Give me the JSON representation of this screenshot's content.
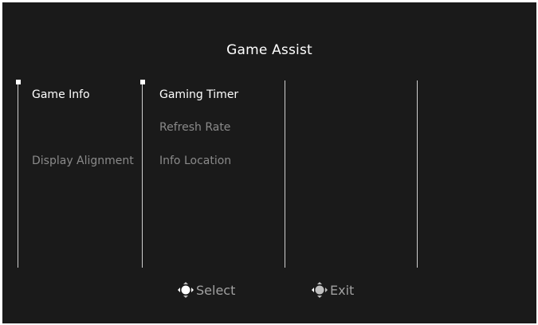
{
  "osd": {
    "title": "Game Assist",
    "column1": [
      {
        "label": "Game Info",
        "state": "active"
      },
      {
        "label": "Display Alignment",
        "state": "inactive"
      }
    ],
    "column2": [
      {
        "label": "Gaming Timer",
        "state": "active"
      },
      {
        "label": "Refresh Rate",
        "state": "inactive"
      },
      {
        "label": "Info Location",
        "state": "inactive"
      }
    ]
  },
  "footer": {
    "select_label": "Select",
    "exit_label": "Exit",
    "select_icon": "joystick-select-icon",
    "exit_icon": "joystick-exit-icon"
  },
  "colors": {
    "background": "#1a1a1a",
    "active_text": "#ffffff",
    "inactive_text": "#8a8a8a",
    "divider": "#cfcfcf"
  }
}
